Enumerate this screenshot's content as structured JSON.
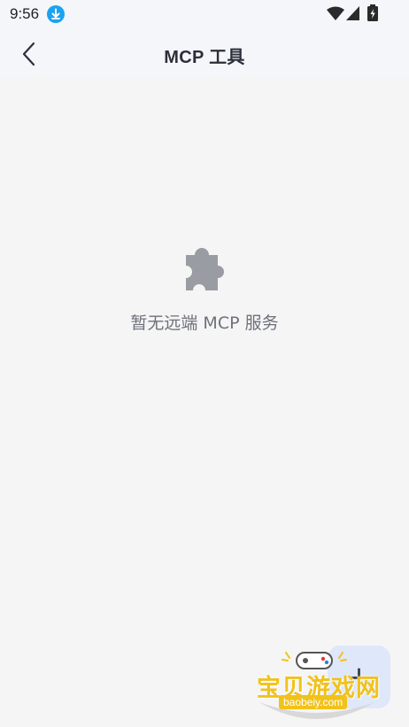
{
  "status_bar": {
    "time": "9:56",
    "icons": [
      "download-icon",
      "wifi-icon",
      "signal-icon",
      "battery-icon"
    ]
  },
  "header": {
    "back_icon": "chevron-left-icon",
    "title": "MCP 工具"
  },
  "empty_state": {
    "icon": "puzzle-icon",
    "message": "暂无远端 MCP 服务"
  },
  "fab": {
    "icon": "plus-icon",
    "label": "+"
  },
  "watermark": {
    "title": "宝贝游戏网",
    "url": "baobeiy.com"
  },
  "colors": {
    "background": "#f5f5f5",
    "header_bg": "#f4f6fa",
    "title_text": "#2b2f3a",
    "empty_icon": "#9a9ca3",
    "empty_text": "#6e717a",
    "fab_bg": "#dfe7fb",
    "download_badge": "#1aa3f0",
    "watermark_yellow": "#f1c21b"
  }
}
